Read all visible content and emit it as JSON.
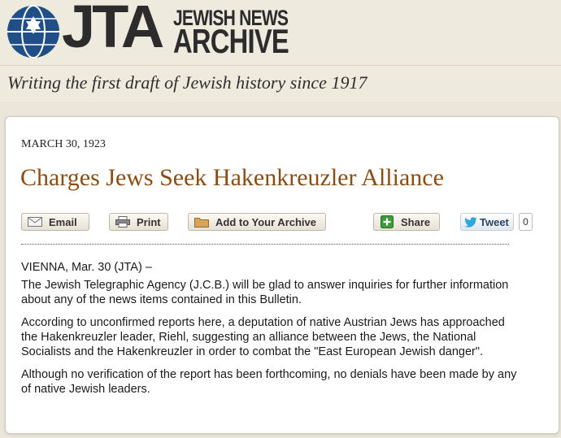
{
  "header": {
    "logo_mark": "JTA",
    "logo_line1": "JEWISH NEWS",
    "logo_line2": "ARCHIVE",
    "tagline": "Writing the first draft of Jewish history since 1917"
  },
  "article": {
    "date": "MARCH 30, 1923",
    "headline": "Charges Jews Seek Hakenkreuzler Alliance",
    "dateline": "VIENNA, Mar. 30 (JTA) –",
    "paragraphs": [
      "The Jewish Telegraphic Agency (J.C.B.) will be glad to answer inquiries for further information about any of the news items contained in this Bulletin.",
      "According to unconfirmed reports here, a deputation of native Austrian Jews has approached the Hakenkreuzler leader, Riehl, suggesting an alliance between the Jews, the National Socialists and the Hakenkreuzler in order to combat the \"East European Jewish danger\".",
      "Although no verification of the report has been forthcoming, no denials have been made by any of native Jewish leaders."
    ]
  },
  "actions": {
    "email_label": "Email",
    "print_label": "Print",
    "archive_label": "Add to Your Archive",
    "share_label": "Share",
    "tweet_label": "Tweet",
    "tweet_count": "0"
  },
  "colors": {
    "headline": "#8b4d12",
    "logo_blue": "#1f4f86",
    "share_green": "#3d9a3d",
    "twitter_blue": "#2ea7df"
  }
}
